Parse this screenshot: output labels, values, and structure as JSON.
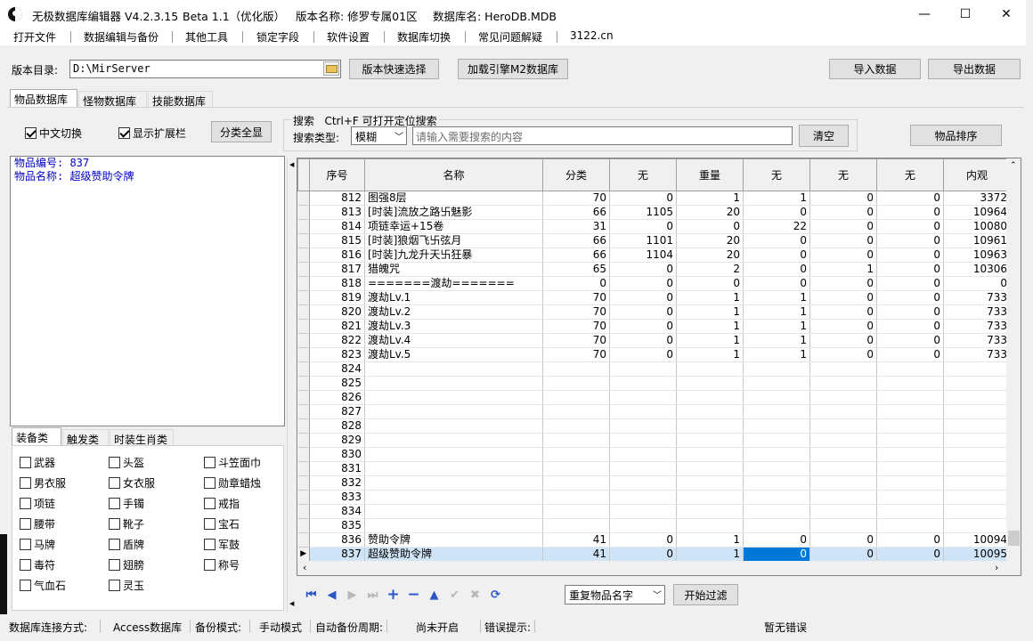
{
  "titlebar": {
    "app": "无极数据库编辑器 V4.2.3.15",
    "beta": "Beta 1.1（优化版）",
    "version_name": "版本名称: 修罗专属01区",
    "db_name": "数据库名: HeroDB.MDB",
    "minimize": "—",
    "maximize": "☐",
    "close": "✕"
  },
  "menu": [
    "打开文件",
    "数据编辑与备份",
    "其他工具",
    "锁定字段",
    "软件设置",
    "数据库切换",
    "常见问题解疑",
    "3122.cn"
  ],
  "toolbar": {
    "dir_label": "版本目录:",
    "dir_value": "D:\\MirServer",
    "quick_select": "版本快速选择",
    "load_m2": "加载引擎M2数据库",
    "import": "导入数据",
    "export": "导出数据"
  },
  "tabs": [
    "物品数据库",
    "怪物数据库",
    "技能数据库"
  ],
  "options": {
    "cn_switch": "中文切换",
    "show_ext": "显示扩展栏",
    "show_all": "分类全显"
  },
  "search": {
    "title": "搜索",
    "hint": "Ctrl+F 可打开定位搜索",
    "type_label": "搜索类型:",
    "type_value": "模糊",
    "placeholder": "请输入需要搜索的内容",
    "clear": "清空",
    "sort": "物品排序"
  },
  "info": {
    "line1": "物品编号: 837",
    "line2": "物品名称: 超级赞助令牌"
  },
  "category_tabs": [
    "装备类",
    "触发类",
    "时装生肖类"
  ],
  "categories": [
    "武器",
    "头盔",
    "斗笠面巾",
    "男衣服",
    "女衣服",
    "勋章蜡烛",
    "项链",
    "手镯",
    "戒指",
    "腰带",
    "靴子",
    "宝石",
    "马牌",
    "盾牌",
    "军鼓",
    "毒符",
    "翅膀",
    "称号",
    "气血石",
    "灵玉"
  ],
  "grid": {
    "headers": [
      "序号",
      "名称",
      "分类",
      "无",
      "重量",
      "无",
      "无",
      "无",
      "内观"
    ],
    "rows": [
      [
        "812",
        "图强8层",
        "70",
        "0",
        "1",
        "1",
        "0",
        "0",
        "3372"
      ],
      [
        "813",
        "[时装]流放之路卐魅影",
        "66",
        "1105",
        "20",
        "0",
        "0",
        "0",
        "10964"
      ],
      [
        "814",
        "项链幸运+15卷",
        "31",
        "0",
        "0",
        "22",
        "0",
        "0",
        "10080"
      ],
      [
        "815",
        "[时装]狼烟飞卐弦月",
        "66",
        "1101",
        "20",
        "0",
        "0",
        "0",
        "10961"
      ],
      [
        "816",
        "[时装]九龙升天卐狂暴",
        "66",
        "1104",
        "20",
        "0",
        "0",
        "0",
        "10963"
      ],
      [
        "817",
        "猎魄咒",
        "65",
        "0",
        "2",
        "0",
        "1",
        "0",
        "10306"
      ],
      [
        "818",
        "=======渡劫=======",
        "0",
        "0",
        "0",
        "0",
        "0",
        "0",
        "0"
      ],
      [
        "819",
        "渡劫Lv.1",
        "70",
        "0",
        "1",
        "1",
        "0",
        "0",
        "733"
      ],
      [
        "820",
        "渡劫Lv.2",
        "70",
        "0",
        "1",
        "1",
        "0",
        "0",
        "733"
      ],
      [
        "821",
        "渡劫Lv.3",
        "70",
        "0",
        "1",
        "1",
        "0",
        "0",
        "733"
      ],
      [
        "822",
        "渡劫Lv.4",
        "70",
        "0",
        "1",
        "1",
        "0",
        "0",
        "733"
      ],
      [
        "823",
        "渡劫Lv.5",
        "70",
        "0",
        "1",
        "1",
        "0",
        "0",
        "733"
      ],
      [
        "824",
        "",
        "",
        "",
        "",
        "",
        "",
        "",
        ""
      ],
      [
        "825",
        "",
        "",
        "",
        "",
        "",
        "",
        "",
        ""
      ],
      [
        "826",
        "",
        "",
        "",
        "",
        "",
        "",
        "",
        ""
      ],
      [
        "827",
        "",
        "",
        "",
        "",
        "",
        "",
        "",
        ""
      ],
      [
        "828",
        "",
        "",
        "",
        "",
        "",
        "",
        "",
        ""
      ],
      [
        "829",
        "",
        "",
        "",
        "",
        "",
        "",
        "",
        ""
      ],
      [
        "830",
        "",
        "",
        "",
        "",
        "",
        "",
        "",
        ""
      ],
      [
        "831",
        "",
        "",
        "",
        "",
        "",
        "",
        "",
        ""
      ],
      [
        "832",
        "",
        "",
        "",
        "",
        "",
        "",
        "",
        ""
      ],
      [
        "833",
        "",
        "",
        "",
        "",
        "",
        "",
        "",
        ""
      ],
      [
        "834",
        "",
        "",
        "",
        "",
        "",
        "",
        "",
        ""
      ],
      [
        "835",
        "",
        "",
        "",
        "",
        "",
        "",
        "",
        ""
      ],
      [
        "836",
        "赞助令牌",
        "41",
        "0",
        "1",
        "0",
        "0",
        "0",
        "10094"
      ],
      [
        "837",
        "超级赞助令牌",
        "41",
        "0",
        "1",
        "0",
        "0",
        "0",
        "10095"
      ]
    ],
    "selected_row": 25,
    "current_col": 5
  },
  "filter": {
    "dropdown": "重复物品名字",
    "start": "开始过滤"
  },
  "status": {
    "conn_label": "数据库连接方式:",
    "conn_value": "Access数据库",
    "backup_label": "备份模式:",
    "backup_value": "手动模式",
    "auto_label": "自动备份周期:",
    "auto_value": "尚未开启",
    "err_label": "错误提示:",
    "err_value": "暂无错误"
  },
  "colors": {
    "info_text": "#0000c8",
    "selection": "#0078d7",
    "row_highlight": "#cfe4f7"
  }
}
